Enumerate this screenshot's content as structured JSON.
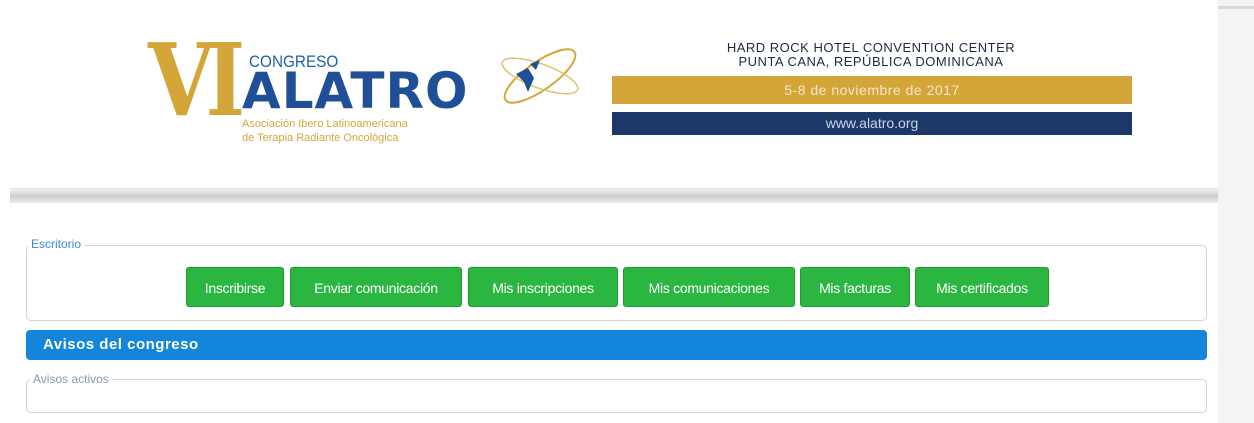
{
  "header": {
    "logo_roman": "VI",
    "logo_congreso": "CONGRESO",
    "logo_name": "ALATRO",
    "logo_sub_1": "Asociación Ibero Latinoamericana",
    "logo_sub_2": "de Terapia Radiante Oncológica",
    "venue_1": "HARD ROCK HOTEL CONVENTION CENTER",
    "venue_2": "PUNTA CANA, REPÚBLICA DOMINICANA",
    "dates": "5-8 de noviembre de 2017",
    "website": "www.alatro.org",
    "colors": {
      "gold": "#d4a63a",
      "navy": "#1c3869",
      "blue": "#1f4f96"
    }
  },
  "escritorio": {
    "legend": "Escritorio",
    "buttons": [
      {
        "label": "Inscribirse"
      },
      {
        "label": "Enviar comunicación"
      },
      {
        "label": "Mis inscripciones"
      },
      {
        "label": "Mis comunicaciones"
      },
      {
        "label": "Mis facturas"
      },
      {
        "label": "Mis certificados"
      }
    ],
    "button_color": "#2ab640"
  },
  "avisos": {
    "title": "Avisos del congreso",
    "active_legend": "Avisos activos",
    "bar_color": "#1386db"
  }
}
